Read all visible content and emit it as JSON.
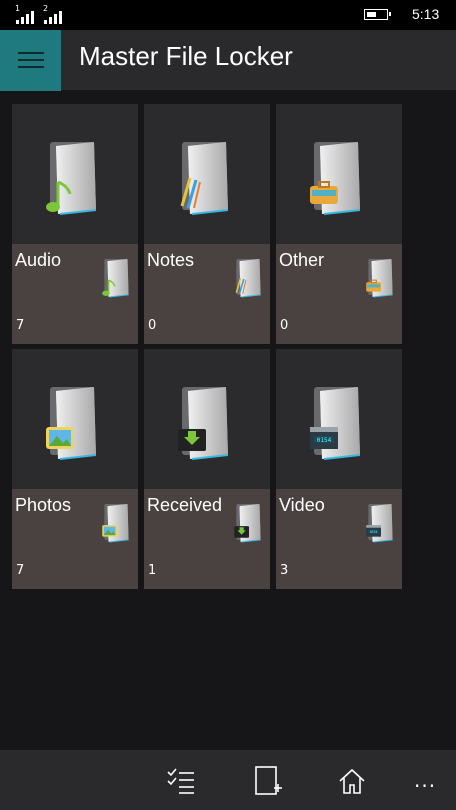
{
  "status": {
    "sim1": "1",
    "sim2": "2",
    "battery_level": 0.55,
    "time": "5:13"
  },
  "header": {
    "title": "Master File Locker",
    "accent": "#1f7a80"
  },
  "folders": [
    {
      "name": "Audio",
      "count": "7",
      "icon": "music-note-icon"
    },
    {
      "name": "Notes",
      "count": "0",
      "icon": "pencils-icon"
    },
    {
      "name": "Other",
      "count": "0",
      "icon": "briefcase-icon"
    },
    {
      "name": "Photos",
      "count": "7",
      "icon": "picture-icon"
    },
    {
      "name": "Received",
      "count": "1",
      "icon": "download-icon"
    },
    {
      "name": "Video",
      "count": "3",
      "icon": "clapperboard-icon"
    }
  ],
  "appbar": {
    "select_icon": "select-list-icon",
    "new_icon": "new-file-icon",
    "home_icon": "home-icon",
    "more": "..."
  }
}
